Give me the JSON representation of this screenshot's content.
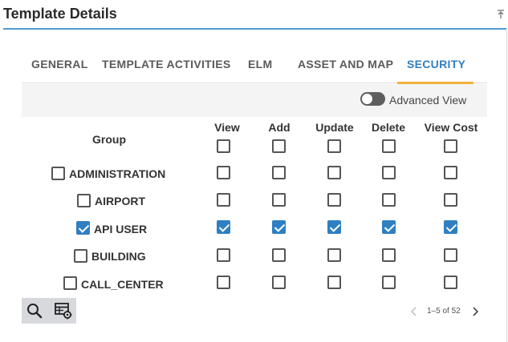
{
  "header": {
    "title": "Template Details"
  },
  "tabs": [
    {
      "label": "GENERAL",
      "active": false
    },
    {
      "label": "TEMPLATE ACTIVITIES",
      "active": false
    },
    {
      "label": "ELM",
      "active": false
    },
    {
      "label": "ASSET AND MAP",
      "active": false
    },
    {
      "label": "SECURITY",
      "active": true
    }
  ],
  "advanced_view": {
    "label": "Advanced View",
    "enabled": false
  },
  "table": {
    "group_header": "Group",
    "columns": [
      "View",
      "Add",
      "Update",
      "Delete",
      "View Cost"
    ],
    "header_checks": [
      false,
      false,
      false,
      false,
      false
    ],
    "rows": [
      {
        "group": "ADMINISTRATION",
        "selected": false,
        "perms": [
          false,
          false,
          false,
          false,
          false
        ]
      },
      {
        "group": "AIRPORT",
        "selected": false,
        "perms": [
          false,
          false,
          false,
          false,
          false
        ]
      },
      {
        "group": "API USER",
        "selected": true,
        "perms": [
          true,
          true,
          true,
          true,
          true
        ]
      },
      {
        "group": "BUILDING",
        "selected": false,
        "perms": [
          false,
          false,
          false,
          false,
          false
        ]
      },
      {
        "group": "CALL_CENTER",
        "selected": false,
        "perms": [
          false,
          false,
          false,
          false,
          false
        ]
      }
    ]
  },
  "pager": {
    "text": "1–5 of 52"
  },
  "colors": {
    "accent": "#2f7fc1",
    "tab_indicator": "#f0b23c",
    "header_line": "#4a9ad8"
  }
}
